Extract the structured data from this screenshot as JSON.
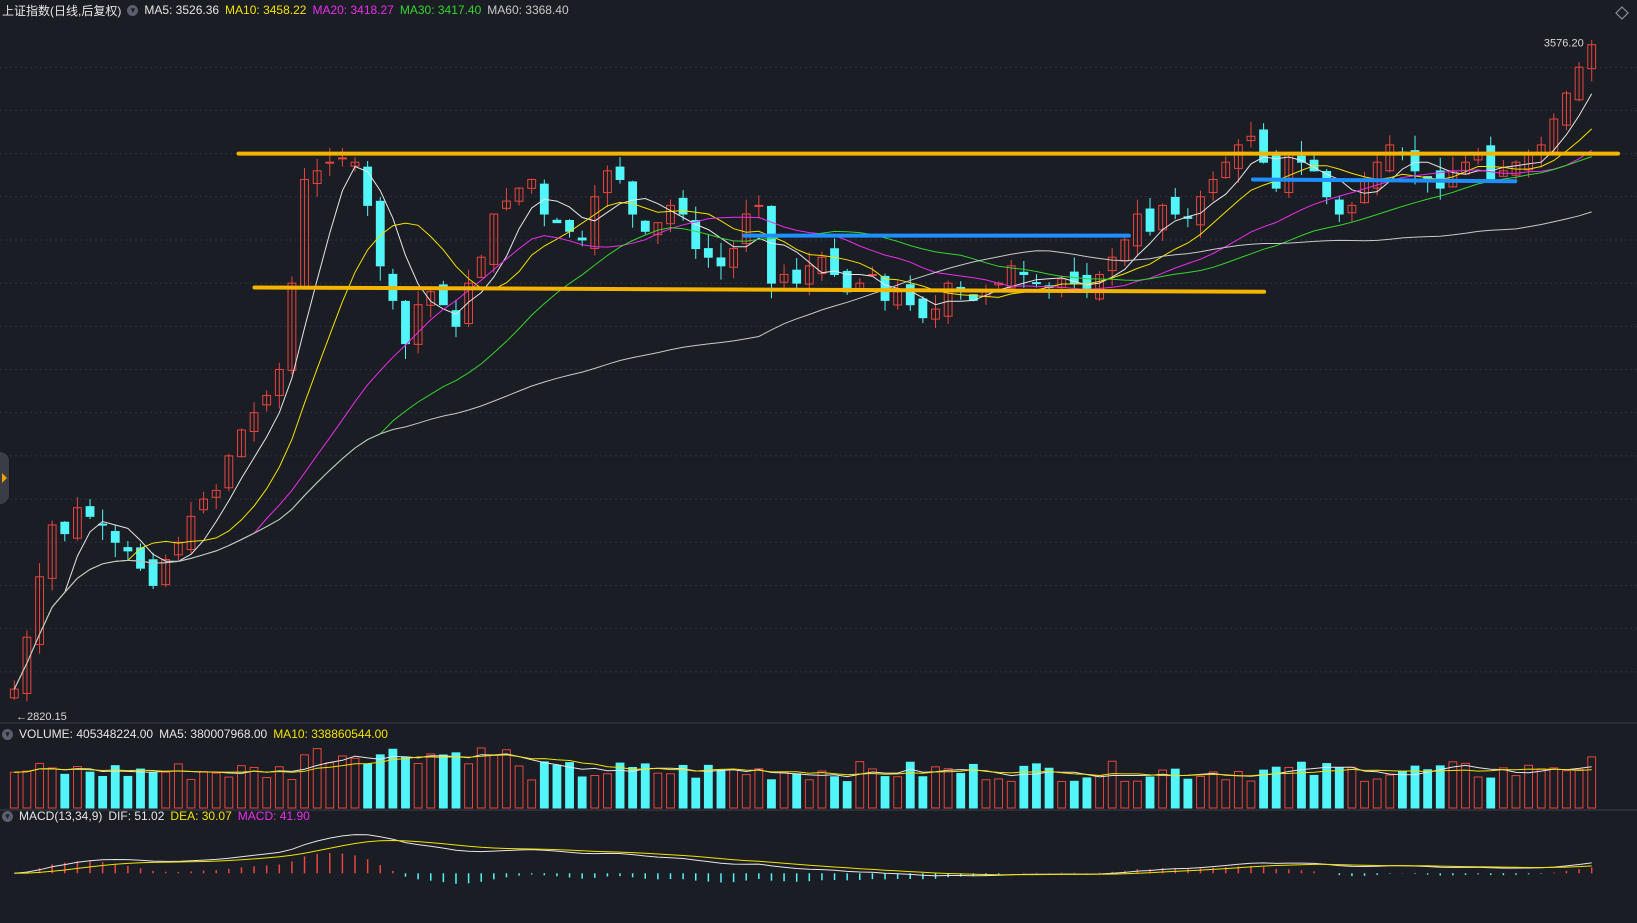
{
  "header": {
    "index_name": "上证指数(日线,后复权)",
    "ma_items": [
      {
        "label": "MA5: 3526.36",
        "color": "#e6e6e6"
      },
      {
        "label": "MA10: 3458.22",
        "color": "#f2e200"
      },
      {
        "label": "MA20: 3418.27",
        "color": "#ea2ded"
      },
      {
        "label": "MA30: 3417.40",
        "color": "#35d42f"
      },
      {
        "label": "MA60: 3368.40",
        "color": "#c9c9c9"
      }
    ]
  },
  "volume_header": {
    "label": "VOLUME: 405348224.00",
    "ma5": "MA5: 380007968.00",
    "ma10": "MA10: 338860544.00"
  },
  "macd_header": {
    "label": "MACD(13,34,9)",
    "dif": "DIF: 51.02",
    "dea": "DEA: 30.07",
    "macd": "MACD: 41.90"
  },
  "colors": {
    "background": "#1b1d24",
    "up": "#e8453c",
    "down": "#52f5f8",
    "ma5": "#e6e6e6",
    "ma10": "#f2e200",
    "ma20": "#ea2ded",
    "ma30": "#35d42f",
    "ma60": "#c9c9c9",
    "resistance_line": "#f5b400",
    "support_line": "#1e8fff"
  },
  "chart_data": {
    "type": "candlestick",
    "title": "上证指数(日线,后复权)",
    "price_markers": {
      "high": "3576.20",
      "low": "2820.15"
    },
    "price_range": [
      2800,
      3600
    ],
    "series_note": "approximate daily closes read from the chart",
    "closes": [
      2830,
      2890,
      2960,
      3020,
      3010,
      3040,
      3030,
      3020,
      3000,
      2990,
      2970,
      2950,
      2980,
      3000,
      3030,
      3050,
      3060,
      3100,
      3130,
      3150,
      3170,
      3200,
      3300,
      3420,
      3430,
      3440,
      3445,
      3440,
      3390,
      3320,
      3280,
      3230,
      3275,
      3290,
      3275,
      3250,
      3300,
      3330,
      3380,
      3395,
      3410,
      3420,
      3380,
      3370,
      3360,
      3350,
      3400,
      3430,
      3420,
      3380,
      3360,
      3370,
      3390,
      3380,
      3340,
      3330,
      3320,
      3340,
      3380,
      3390,
      3300,
      3310,
      3300,
      3320,
      3330,
      3310,
      3290,
      3300,
      3310,
      3280,
      3290,
      3275,
      3260,
      3270,
      3300,
      3290,
      3280,
      3290,
      3300,
      3320,
      3310,
      3300,
      3295,
      3305,
      3300,
      3290,
      3310,
      3330,
      3350,
      3380,
      3360,
      3390,
      3380,
      3375,
      3400,
      3420,
      3440,
      3460,
      3470,
      3440,
      3410,
      3450,
      3440,
      3430,
      3400,
      3380,
      3390,
      3420,
      3440,
      3460,
      3450,
      3430,
      3420,
      3410,
      3430,
      3440,
      3450,
      3420,
      3430,
      3440,
      3450,
      3460,
      3490,
      3520,
      3550,
      3576
    ],
    "moving_averages": [
      "MA5",
      "MA10",
      "MA20",
      "MA30",
      "MA60"
    ],
    "volume": {
      "last": 405348224.0,
      "ma5": 380007968.0,
      "ma10": 338860544.0
    },
    "macd": {
      "params": [
        13,
        34,
        9
      ],
      "dif": 51.02,
      "dea": 30.07,
      "macd": 41.9
    },
    "annotations": [
      {
        "type": "resistance",
        "price": 3450,
        "color": "#f5b400"
      },
      {
        "type": "support",
        "price": 3290,
        "color": "#f5b400"
      },
      {
        "type": "support",
        "price": 3290,
        "color": "#1e8fff"
      },
      {
        "type": "support",
        "price": 3370,
        "color": "#1e8fff"
      }
    ]
  }
}
